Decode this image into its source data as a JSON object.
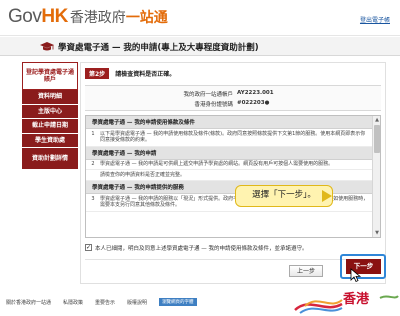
{
  "header": {
    "logo_gov": "Gov",
    "logo_hk": "HK",
    "logo_cn_1": "香港政府",
    "logo_cn_2": "一站通",
    "logout": "登出電子帳"
  },
  "title": "學資處電子通 — 我的申請(專上及大專程度資助計劃)",
  "sidebar": {
    "items": [
      {
        "label": "登記學資處電子通賬戶",
        "active": true
      },
      {
        "label": "資料明細",
        "active": false
      },
      {
        "label": "主版中心",
        "active": false
      },
      {
        "label": "截止申請日期",
        "active": false
      },
      {
        "label": "學生資助處",
        "active": false
      },
      {
        "label": "資助計劃詳情",
        "active": false
      }
    ]
  },
  "step": {
    "badge": "第2步",
    "text": "請檢查資料是否正確。"
  },
  "info": {
    "row1_label": "我的政府一站通帳戶",
    "row1_value": "AY2223.001",
    "row2_label": "香港身份證號碼",
    "row2_value": "#022203●"
  },
  "terms": {
    "section1_title": "學資處電子通 — 我的申請使用條款及條件",
    "items1": [
      {
        "num": "1",
        "text": "以下是學資處電子通 — 我的申請使用條款及條件(條款)。政府同意按照條款提供下文第1節的服務。使用本網頁即表示你同意接受條款的約束。"
      }
    ],
    "section2_title": "學資處電子通 — 我的申請",
    "items2": [
      {
        "num": "2",
        "text": "學資處電子通 — 我的申請是可供網上遞交申請予學資處的網站。網頁設有用戶可按個人需要使用的服務。"
      },
      {
        "num": "",
        "text": "請檢查你的申請資料是否正確並完整。"
      }
    ],
    "section3_title": "學資處電子通 — 我的申請提供的服務",
    "items3": [
      {
        "num": "3",
        "text": "學資處電子通 — 我的申請的服務以「現況」形式提供。政府不保證服務不會中斷、或沒有任何錯誤。用戶如使用服務時，需要本支另行同意其他條款及條件。"
      }
    ]
  },
  "agree_text": "本人已細閱，明白及同意上述學資處電子通 — 我的申請使用條款及條件，並承諾遵守。",
  "buttons": {
    "prev": "上一步",
    "next": "下一步"
  },
  "callout": "選擇「下一步」。",
  "footer": {
    "links": [
      "關於香港政府一站通",
      "私隱政策",
      "重要告示",
      "版權說明"
    ],
    "badge": "瀏覽網頁的字體",
    "brand": "香港"
  },
  "colors": {
    "accent": "#8a1c1c",
    "brand_orange": "#e36c0a",
    "highlight": "#2f86d8",
    "callout_bg": "#fff3b0"
  }
}
